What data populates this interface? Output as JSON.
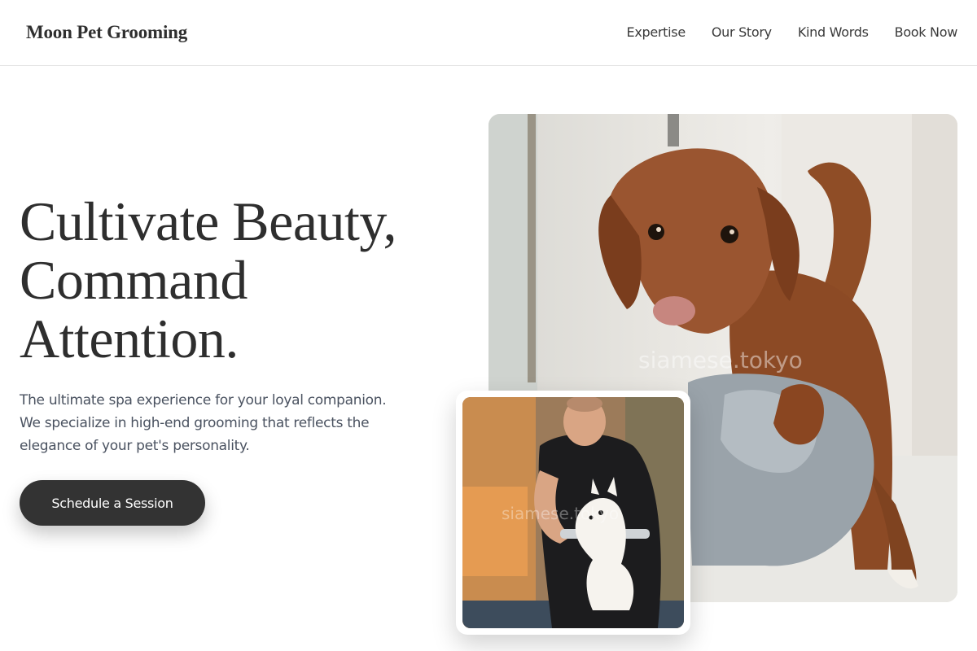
{
  "header": {
    "brand": "Moon Pet Grooming",
    "nav": [
      "Expertise",
      "Our Story",
      "Kind Words",
      "Book Now"
    ]
  },
  "hero": {
    "headline_lines": [
      "Cultivate Beauty,",
      "Command",
      "Attention."
    ],
    "subtext": "The ultimate spa experience for your loyal companion. We specialize in high-end grooming that reflects the elegance of your pet's personality.",
    "cta_label": "Schedule a Session"
  },
  "images": {
    "main_watermark": "siamese.tokyo",
    "inset_watermark": "siamese.tokyo"
  },
  "colors": {
    "text_dark": "#2e2e2e",
    "subtext": "#4a5260",
    "button_bg": "#333333",
    "button_text": "#ffffff"
  }
}
